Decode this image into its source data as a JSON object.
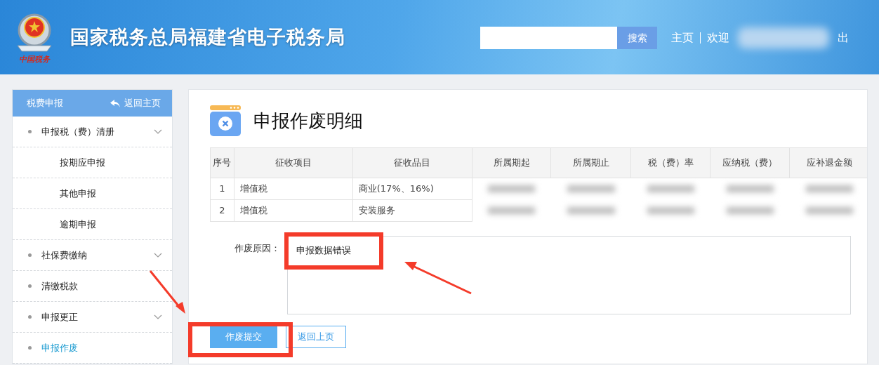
{
  "header": {
    "emblem_caption": "中国税务",
    "title": "国家税务总局福建省电子税务局",
    "search": {
      "button": "搜索"
    },
    "nav": [
      "主页",
      "欢迎"
    ],
    "user_tail": "出"
  },
  "sidebar": {
    "title": "税费申报",
    "back_link": "返回主页",
    "items": [
      {
        "label": "申报税（费）清册",
        "expandable": true,
        "selected": false,
        "children": [
          {
            "label": "按期应申报",
            "selected": false
          },
          {
            "label": "其他申报",
            "selected": false
          },
          {
            "label": "逾期申报",
            "selected": false
          }
        ]
      },
      {
        "label": "社保费缴纳",
        "expandable": true,
        "selected": false
      },
      {
        "label": "清缴税款",
        "expandable": false,
        "selected": false
      },
      {
        "label": "申报更正",
        "expandable": true,
        "selected": false
      },
      {
        "label": "申报作废",
        "expandable": false,
        "selected": true
      }
    ]
  },
  "page": {
    "title": "申报作废明细",
    "table": {
      "columns": [
        "序号",
        "征收项目",
        "征收品目",
        "所属期起",
        "所属期止",
        "税（费）率",
        "应纳税（费）",
        "应补退金额"
      ],
      "rows": [
        [
          "1",
          "增值税",
          "商业(17%、16%)"
        ],
        [
          "2",
          "增值税",
          "安装服务"
        ]
      ]
    },
    "reason": {
      "label": "作废原因：",
      "value": "申报数据错误"
    },
    "buttons": [
      {
        "label": "作废提交",
        "kind": "primary"
      },
      {
        "label": "返回上页",
        "kind": "outline"
      }
    ]
  }
}
